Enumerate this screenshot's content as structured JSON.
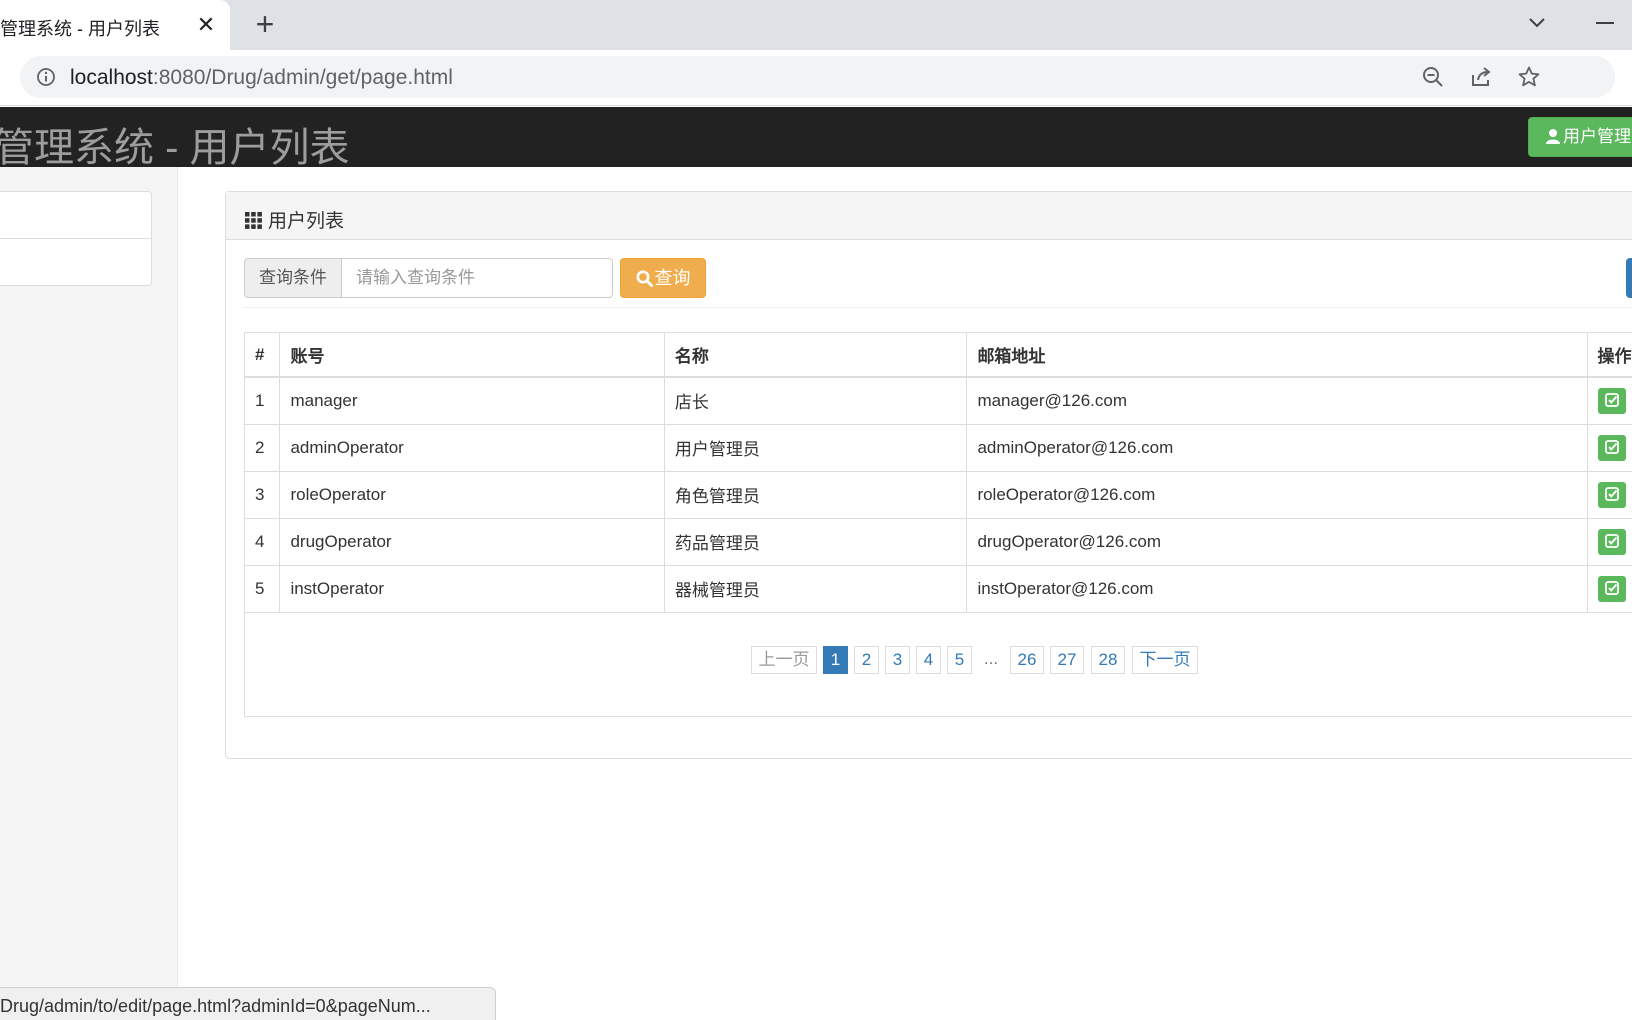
{
  "browser": {
    "tab_title": "管理系统 - 用户列表",
    "url_host": "localhost",
    "url_rest": ":8080/Drug/admin/get/page.html",
    "status_text": "Drug/admin/to/edit/page.html?adminId=0&pageNum..."
  },
  "navbar": {
    "brand": "息管理系统 - 用户列表",
    "user_button": "用户管理"
  },
  "panel": {
    "title": "用户列表",
    "search_addon": "查询条件",
    "search_placeholder": "请输入查询条件",
    "query_button": "查询"
  },
  "table": {
    "headers": [
      "#",
      "账号",
      "名称",
      "邮箱地址",
      "操作"
    ],
    "rows": [
      {
        "no": "1",
        "account": "manager",
        "name": "店长",
        "email": "manager@126.com"
      },
      {
        "no": "2",
        "account": "adminOperator",
        "name": "用户管理员",
        "email": "adminOperator@126.com"
      },
      {
        "no": "3",
        "account": "roleOperator",
        "name": "角色管理员",
        "email": "roleOperator@126.com"
      },
      {
        "no": "4",
        "account": "drugOperator",
        "name": "药品管理员",
        "email": "drugOperator@126.com"
      },
      {
        "no": "5",
        "account": "instOperator",
        "name": "器械管理员",
        "email": "instOperator@126.com"
      }
    ]
  },
  "pagination": {
    "prev": "上一页",
    "pages": [
      "1",
      "2",
      "3",
      "4",
      "5"
    ],
    "ellipsis": "...",
    "tail_pages": [
      "26",
      "27",
      "28"
    ],
    "next": "下一页",
    "current": "1"
  },
  "colors": {
    "navbar_bg": "#222222",
    "success": "#5cb85c",
    "warning": "#f0ad4e",
    "primary": "#337ab7"
  }
}
